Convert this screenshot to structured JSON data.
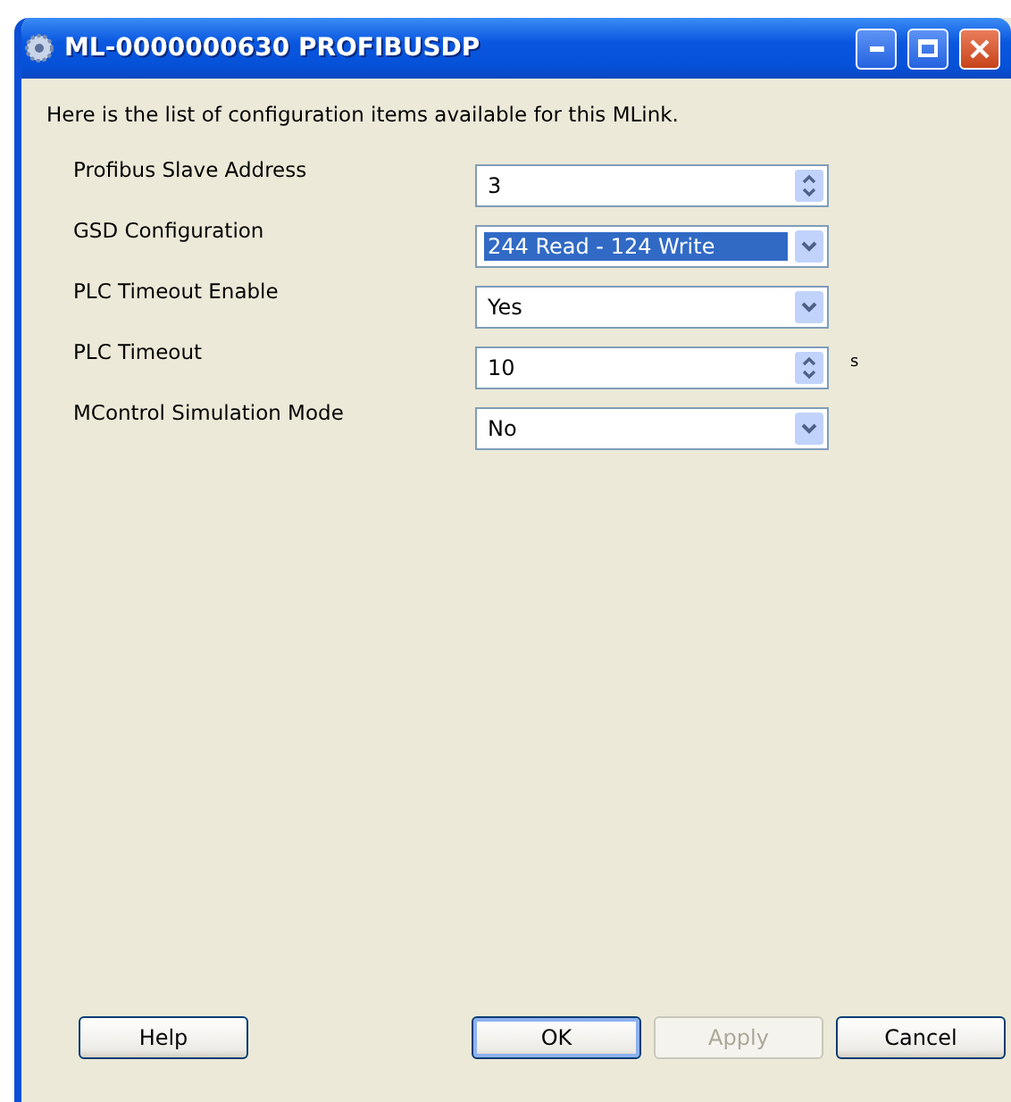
{
  "window": {
    "title": "ML-0000000630 PROFIBUSDP"
  },
  "intro": "Here is the list of configuration items available for this MLink.",
  "settings": [
    {
      "label": "Profibus Slave Address",
      "kind": "spinner",
      "value": "3",
      "focused": false
    },
    {
      "label": "GSD Configuration",
      "kind": "dropdown",
      "value": "244 Read - 124 Write",
      "focused": true
    },
    {
      "label": "PLC Timeout Enable",
      "kind": "dropdown",
      "value": "Yes",
      "focused": false
    },
    {
      "label": "PLC Timeout",
      "kind": "spinner",
      "value": "10",
      "focused": false,
      "unit": "s"
    },
    {
      "label": "MControl Simulation Mode",
      "kind": "dropdown",
      "value": "No",
      "focused": false
    }
  ],
  "buttons": [
    {
      "label": "Help",
      "default": false,
      "disabled": false
    },
    {
      "label": "OK",
      "default": true,
      "disabled": false
    },
    {
      "label": "Apply",
      "default": false,
      "disabled": true
    },
    {
      "label": "Cancel",
      "default": false,
      "disabled": false
    }
  ]
}
